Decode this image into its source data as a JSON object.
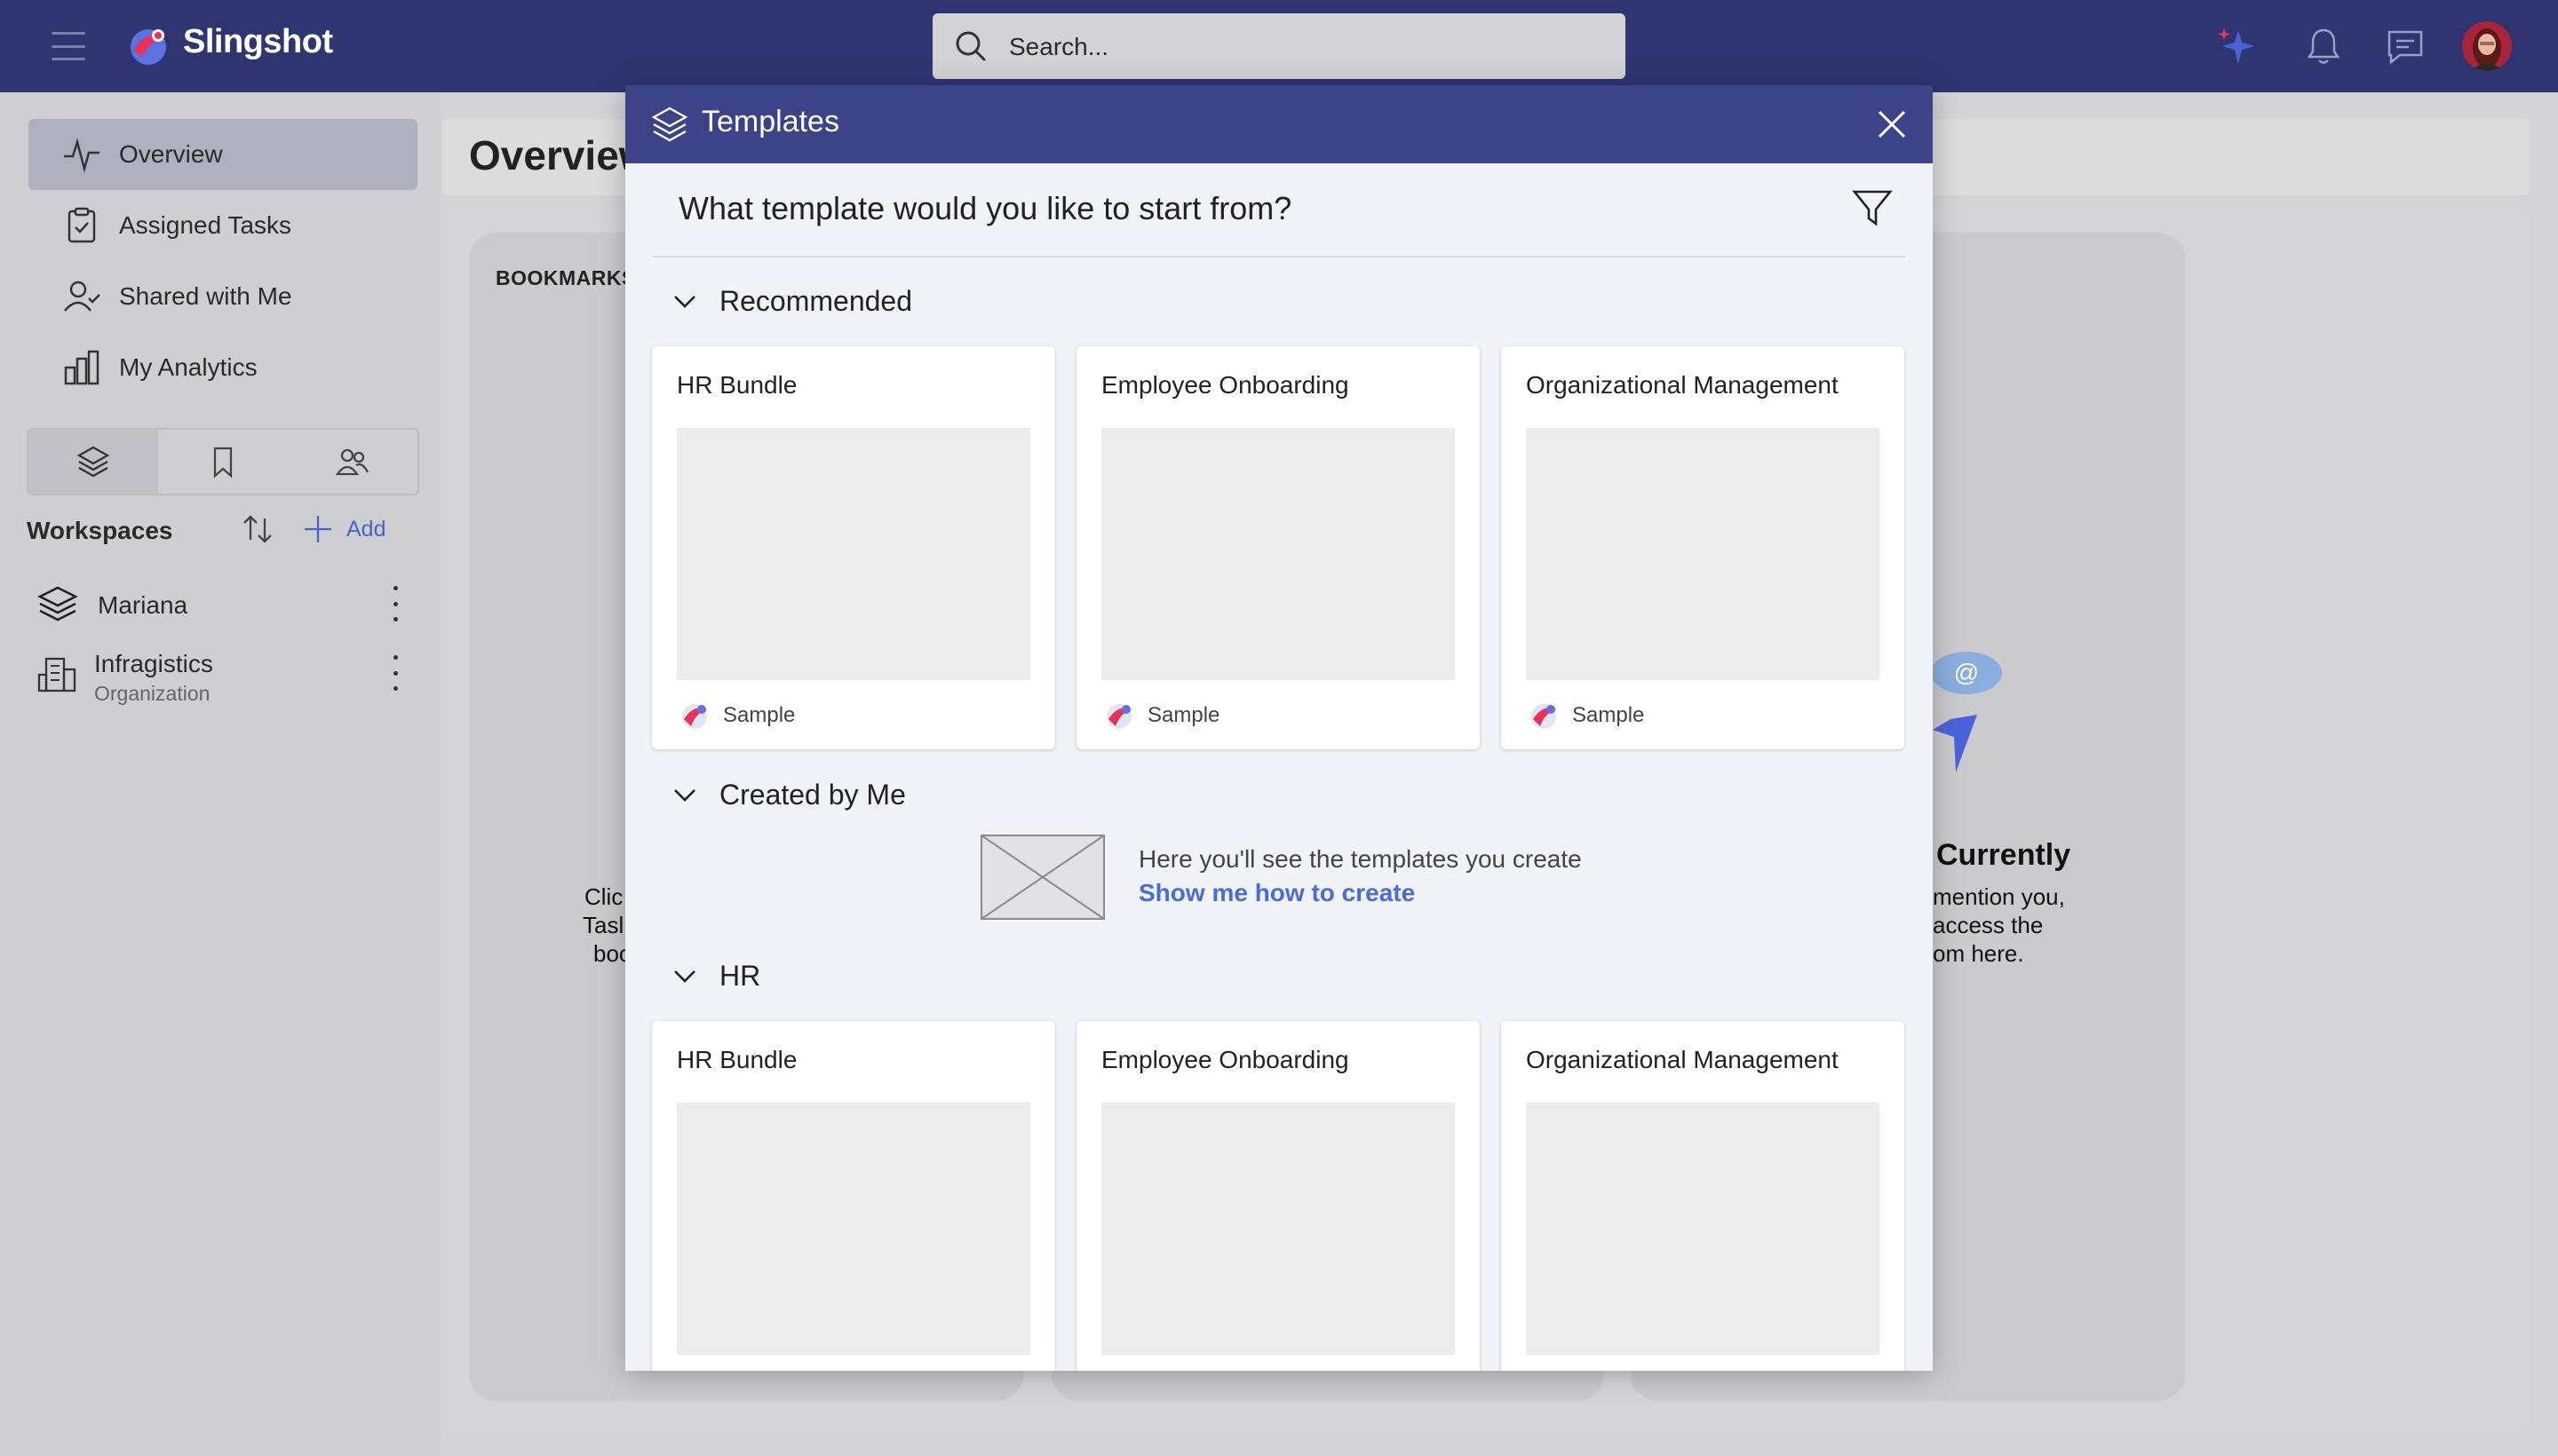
{
  "app": {
    "brand": "Slingshot"
  },
  "search": {
    "placeholder": "Search..."
  },
  "topbar": {
    "icons": [
      "sparkle-icon",
      "bell-icon",
      "chat-icon",
      "avatar"
    ]
  },
  "sidebar": {
    "nav": [
      {
        "label": "Overview",
        "icon": "pulse-icon",
        "active": true
      },
      {
        "label": "Assigned Tasks",
        "icon": "clipboard-icon"
      },
      {
        "label": "Shared with Me",
        "icon": "user-check-icon"
      },
      {
        "label": "My Analytics",
        "icon": "bar-chart-icon"
      }
    ],
    "tabs": [
      "layers-icon",
      "bookmark-icon",
      "people-icon"
    ],
    "workspaces_title": "Workspaces",
    "add_label": "Add",
    "workspaces": [
      {
        "name": "Mariana",
        "sub": ""
      },
      {
        "name": "Infragistics",
        "sub": "Organization"
      }
    ]
  },
  "background": {
    "page_title": "Overview",
    "bookmarks_label": "BOOKMARKS",
    "left_frag": [
      "Clic",
      "Tasl",
      "boo"
    ],
    "right_heading_frag": "Currently",
    "right_frag": [
      "mention you,",
      "access the",
      "om here."
    ]
  },
  "modal": {
    "title": "Templates",
    "question": "What template would you like to start from?",
    "sections": {
      "recommended": "Recommended",
      "created": "Created by Me",
      "hr": "HR"
    },
    "recommended": [
      {
        "name": "HR Bundle",
        "tag": "Sample"
      },
      {
        "name": "Employee Onboarding",
        "tag": "Sample"
      },
      {
        "name": "Organizational Management",
        "tag": "Sample"
      }
    ],
    "hr": [
      {
        "name": "HR Bundle"
      },
      {
        "name": "Employee Onboarding"
      },
      {
        "name": "Organizational Management"
      }
    ],
    "empty": {
      "text": "Here you'll see the templates you create",
      "link": "Show me how to create"
    }
  },
  "colors": {
    "topbar": "#2f3570",
    "modal_header": "#3d4389",
    "link": "#4a6bdc",
    "brand_red": "#e8325a"
  }
}
